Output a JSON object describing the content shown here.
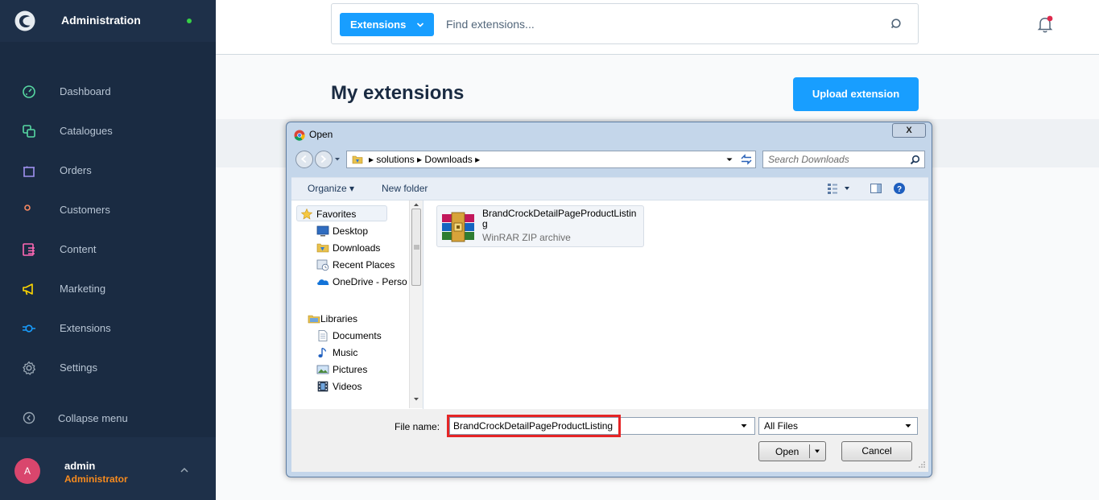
{
  "sidebar": {
    "title": "Administration",
    "nav": [
      {
        "label": "Dashboard",
        "icon": "dashboard-icon",
        "color": "#57d9a3"
      },
      {
        "label": "Catalogues",
        "icon": "catalogue-icon",
        "color": "#57d9a3"
      },
      {
        "label": "Orders",
        "icon": "orders-icon",
        "color": "#a092f0"
      },
      {
        "label": "Customers",
        "icon": "customers-icon",
        "color": "#f88962"
      },
      {
        "label": "Content",
        "icon": "content-icon",
        "color": "#ff68b4"
      },
      {
        "label": "Marketing",
        "icon": "marketing-icon",
        "color": "#ffd700"
      },
      {
        "label": "Extensions",
        "icon": "extensions-icon",
        "color": "#189eff"
      },
      {
        "label": "Settings",
        "icon": "settings-icon",
        "color": "#9aa8b5"
      }
    ],
    "collapse_label": "Collapse menu",
    "user": {
      "initial": "A",
      "name": "admin",
      "role": "Administrator"
    }
  },
  "topbar": {
    "search_type": "Extensions",
    "search_placeholder": "Find extensions..."
  },
  "main": {
    "title": "My extensions",
    "upload_label": "Upload extension"
  },
  "dialog": {
    "title": "Open",
    "close_label": "X",
    "address": "▸  solutions  ▸  Downloads  ▸",
    "search_placeholder": "Search Downloads",
    "organize_label": "Organize ▾",
    "new_folder_label": "New folder",
    "favorites_label": "Favorites",
    "tree": [
      {
        "label": "Desktop",
        "icon": "desktop-icon"
      },
      {
        "label": "Downloads",
        "icon": "downloads-folder-icon"
      },
      {
        "label": "Recent Places",
        "icon": "recent-places-icon"
      },
      {
        "label": "OneDrive - Perso",
        "icon": "onedrive-icon"
      }
    ],
    "libraries_label": "Libraries",
    "libraries": [
      {
        "label": "Documents",
        "icon": "documents-icon"
      },
      {
        "label": "Music",
        "icon": "music-icon"
      },
      {
        "label": "Pictures",
        "icon": "pictures-icon"
      },
      {
        "label": "Videos",
        "icon": "videos-icon"
      }
    ],
    "file": {
      "name": "BrandCrockDetailPageProductListing",
      "type": "WinRAR ZIP archive"
    },
    "file_name_label": "File name:",
    "file_name_value": "BrandCrockDetailPageProductListing",
    "file_type": "All Files",
    "open_label": "Open",
    "cancel_label": "Cancel"
  }
}
